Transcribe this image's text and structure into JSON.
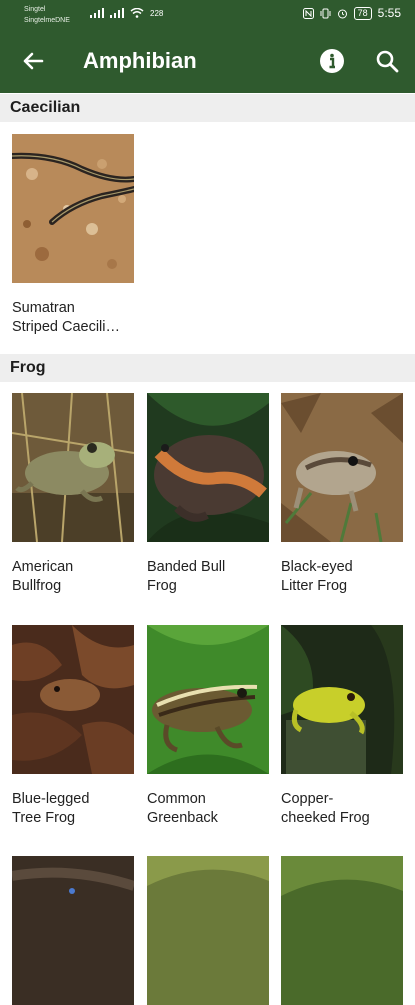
{
  "status_bar": {
    "carrier_line1": "Singtel",
    "carrier_line2": "SingtelmeDNE",
    "net_speed": "228",
    "time": "5:55",
    "battery": "78"
  },
  "app_bar": {
    "title": "Amphibian"
  },
  "sections": {
    "caecilian": {
      "title": "Caecilian",
      "items": [
        {
          "name": "Sumatran\nStriped Caecili…"
        }
      ]
    },
    "frog": {
      "title": "Frog",
      "items": [
        {
          "name": "American\nBullfrog"
        },
        {
          "name": "Banded Bull\nFrog"
        },
        {
          "name": "Black-eyed\nLitter Frog"
        },
        {
          "name": "Blue-legged\nTree Frog"
        },
        {
          "name": "Common\nGreenback"
        },
        {
          "name": "Copper-\ncheeked Frog"
        }
      ]
    }
  },
  "colors": {
    "primary": "#2f5a2e",
    "section_bg": "#eeeeee"
  },
  "icons": [
    "back-arrow-icon",
    "info-icon",
    "search-icon"
  ]
}
